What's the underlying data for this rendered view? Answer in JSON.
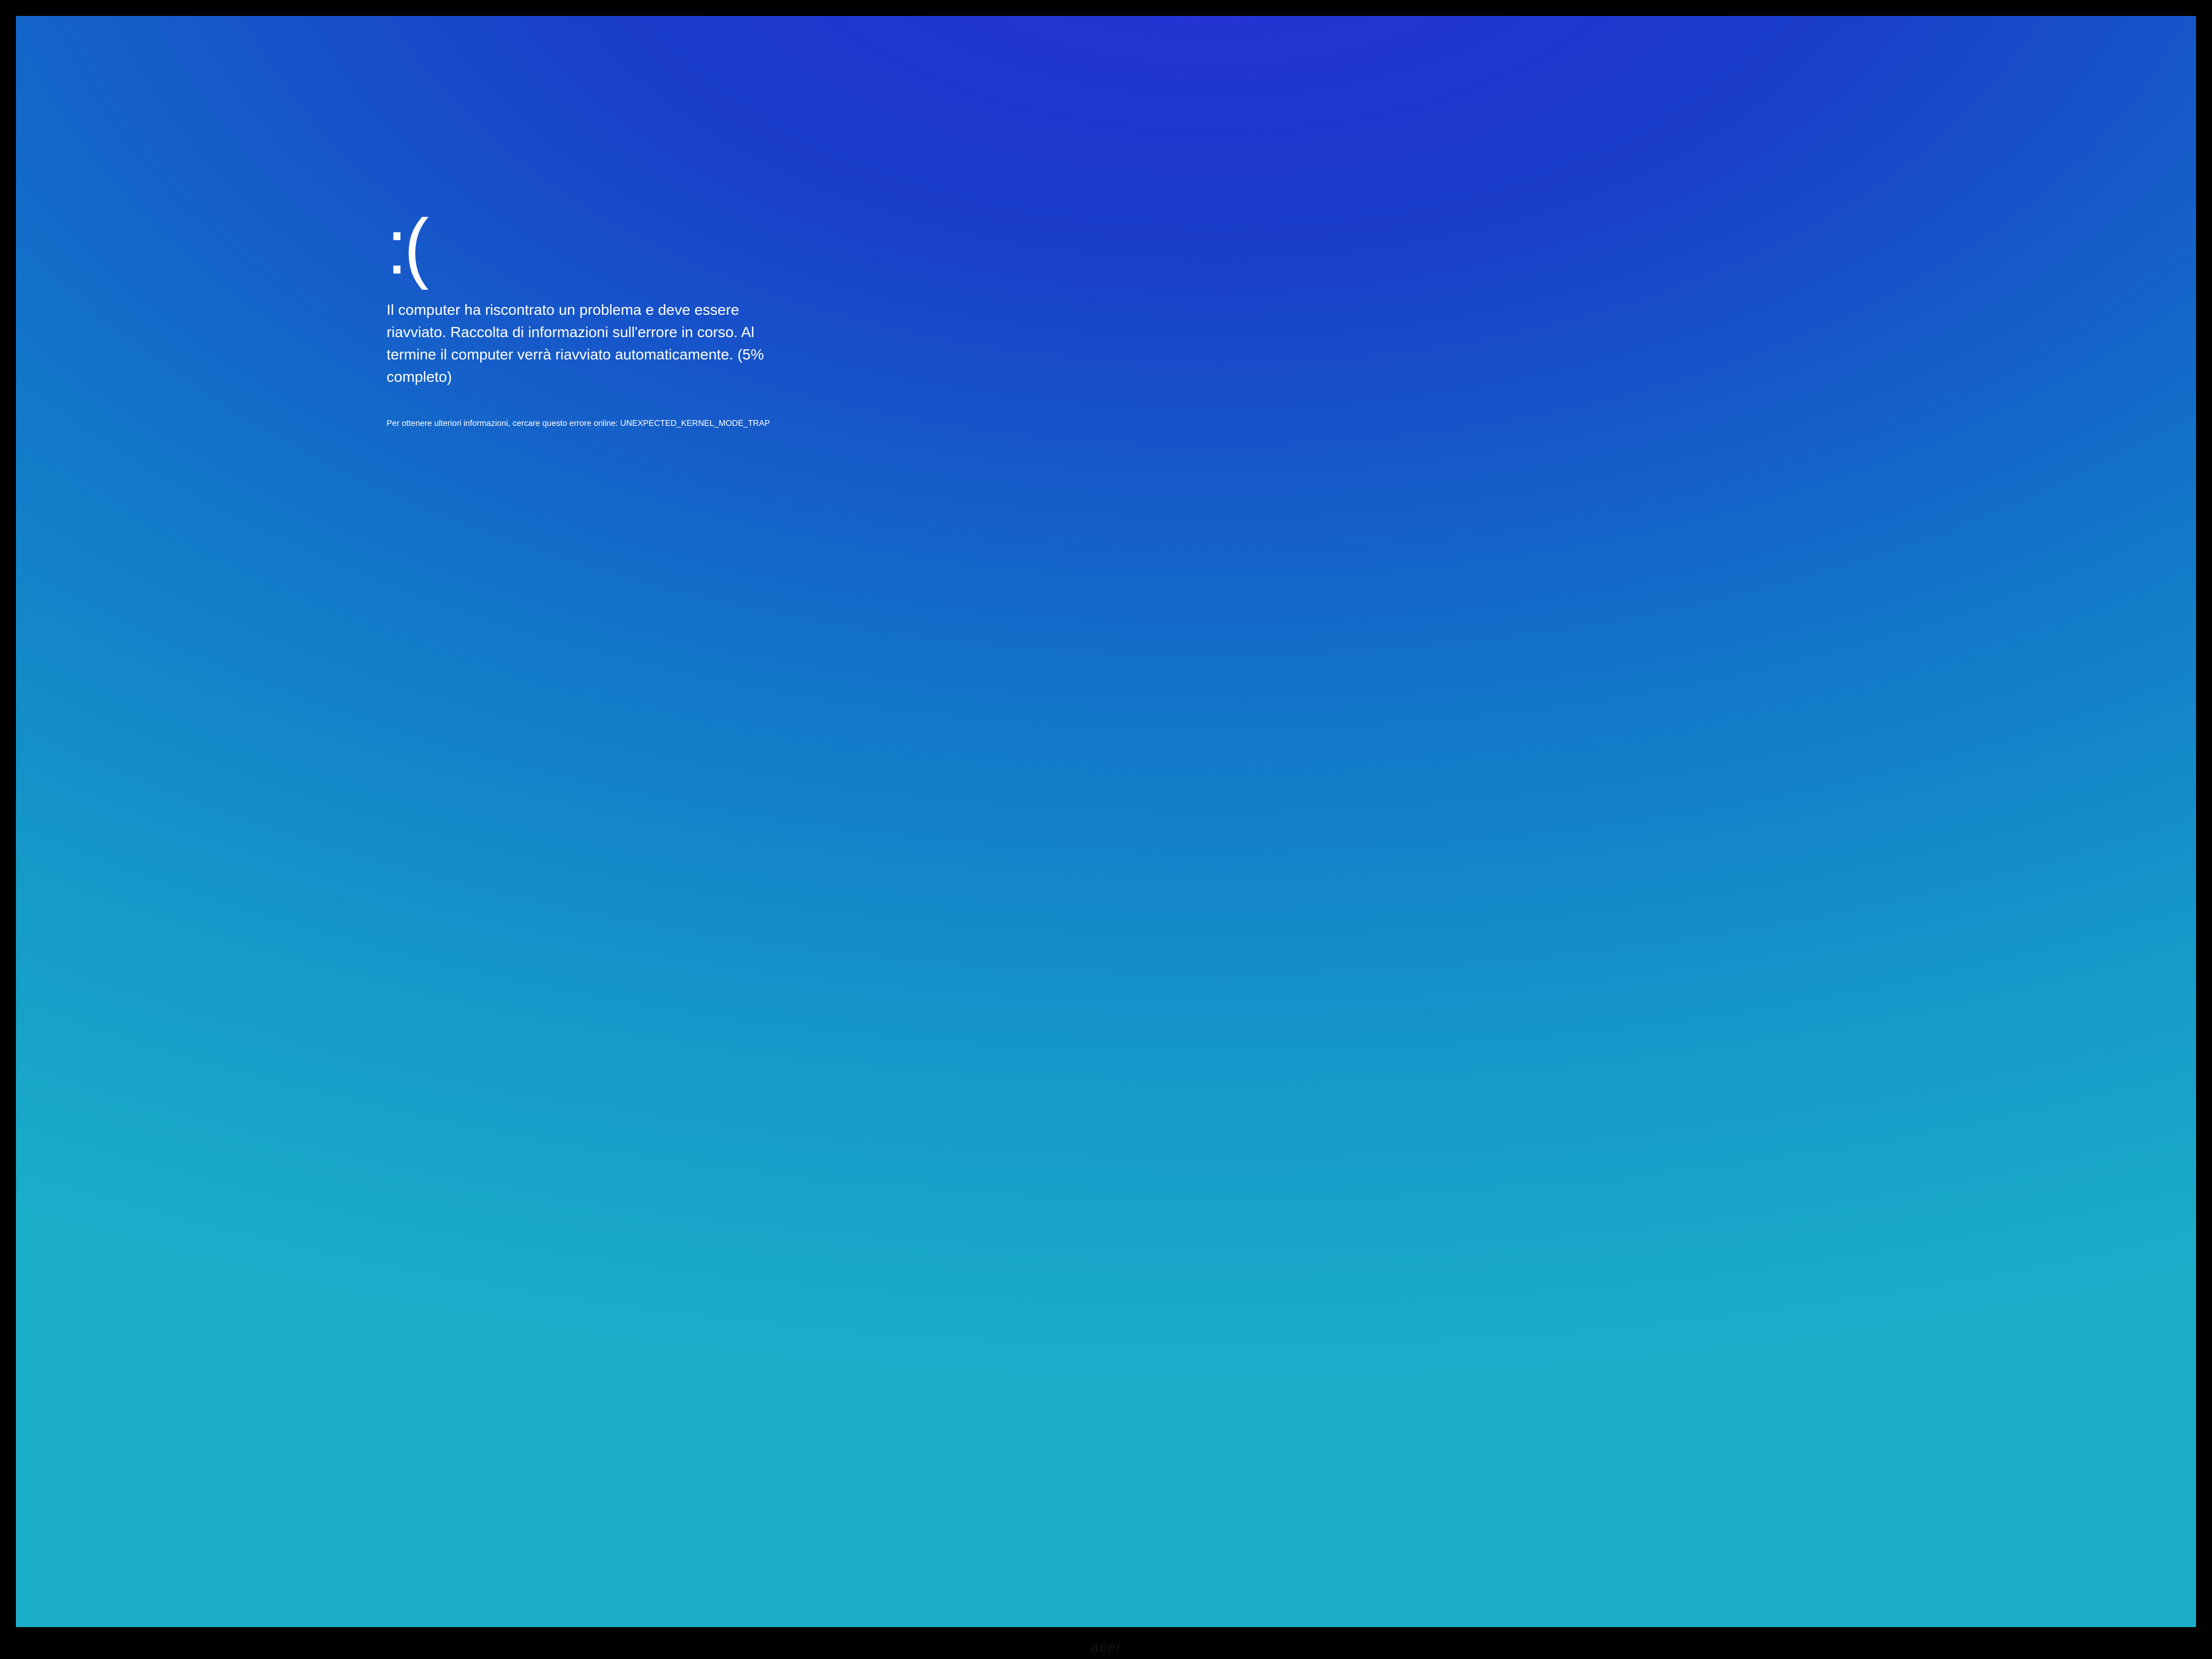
{
  "bsod": {
    "emoticon": ":(",
    "message": "Il computer ha riscontrato un problema e deve essere riavviato. Raccolta di informazioni sull'errore in corso. Al termine il computer verrà riavviato automaticamente. (5% completo)",
    "info_prefix": "Per ottenere ulteriori informazioni, cercare questo errore online: ",
    "error_code": "UNEXPECTED_KERNEL_MODE_TRAP",
    "progress_percent": 5
  },
  "monitor": {
    "brand": "acer"
  }
}
